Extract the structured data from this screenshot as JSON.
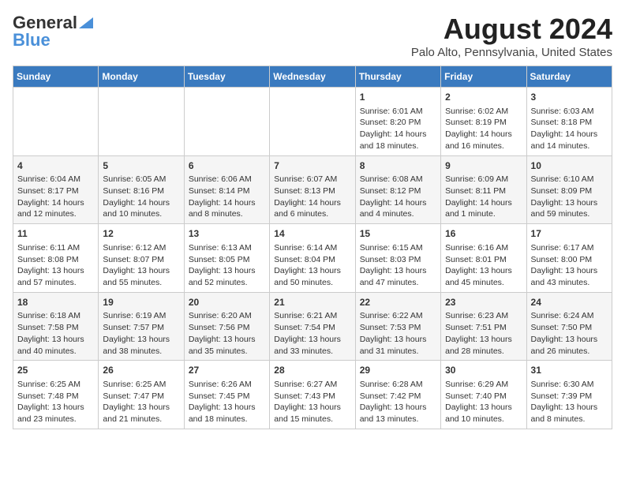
{
  "header": {
    "logo_line1": "General",
    "logo_line2": "Blue",
    "title": "August 2024",
    "subtitle": "Palo Alto, Pennsylvania, United States"
  },
  "days_of_week": [
    "Sunday",
    "Monday",
    "Tuesday",
    "Wednesday",
    "Thursday",
    "Friday",
    "Saturday"
  ],
  "weeks": [
    [
      {
        "day": "",
        "content": ""
      },
      {
        "day": "",
        "content": ""
      },
      {
        "day": "",
        "content": ""
      },
      {
        "day": "",
        "content": ""
      },
      {
        "day": "1",
        "content": "Sunrise: 6:01 AM\nSunset: 8:20 PM\nDaylight: 14 hours\nand 18 minutes."
      },
      {
        "day": "2",
        "content": "Sunrise: 6:02 AM\nSunset: 8:19 PM\nDaylight: 14 hours\nand 16 minutes."
      },
      {
        "day": "3",
        "content": "Sunrise: 6:03 AM\nSunset: 8:18 PM\nDaylight: 14 hours\nand 14 minutes."
      }
    ],
    [
      {
        "day": "4",
        "content": "Sunrise: 6:04 AM\nSunset: 8:17 PM\nDaylight: 14 hours\nand 12 minutes."
      },
      {
        "day": "5",
        "content": "Sunrise: 6:05 AM\nSunset: 8:16 PM\nDaylight: 14 hours\nand 10 minutes."
      },
      {
        "day": "6",
        "content": "Sunrise: 6:06 AM\nSunset: 8:14 PM\nDaylight: 14 hours\nand 8 minutes."
      },
      {
        "day": "7",
        "content": "Sunrise: 6:07 AM\nSunset: 8:13 PM\nDaylight: 14 hours\nand 6 minutes."
      },
      {
        "day": "8",
        "content": "Sunrise: 6:08 AM\nSunset: 8:12 PM\nDaylight: 14 hours\nand 4 minutes."
      },
      {
        "day": "9",
        "content": "Sunrise: 6:09 AM\nSunset: 8:11 PM\nDaylight: 14 hours\nand 1 minute."
      },
      {
        "day": "10",
        "content": "Sunrise: 6:10 AM\nSunset: 8:09 PM\nDaylight: 13 hours\nand 59 minutes."
      }
    ],
    [
      {
        "day": "11",
        "content": "Sunrise: 6:11 AM\nSunset: 8:08 PM\nDaylight: 13 hours\nand 57 minutes."
      },
      {
        "day": "12",
        "content": "Sunrise: 6:12 AM\nSunset: 8:07 PM\nDaylight: 13 hours\nand 55 minutes."
      },
      {
        "day": "13",
        "content": "Sunrise: 6:13 AM\nSunset: 8:05 PM\nDaylight: 13 hours\nand 52 minutes."
      },
      {
        "day": "14",
        "content": "Sunrise: 6:14 AM\nSunset: 8:04 PM\nDaylight: 13 hours\nand 50 minutes."
      },
      {
        "day": "15",
        "content": "Sunrise: 6:15 AM\nSunset: 8:03 PM\nDaylight: 13 hours\nand 47 minutes."
      },
      {
        "day": "16",
        "content": "Sunrise: 6:16 AM\nSunset: 8:01 PM\nDaylight: 13 hours\nand 45 minutes."
      },
      {
        "day": "17",
        "content": "Sunrise: 6:17 AM\nSunset: 8:00 PM\nDaylight: 13 hours\nand 43 minutes."
      }
    ],
    [
      {
        "day": "18",
        "content": "Sunrise: 6:18 AM\nSunset: 7:58 PM\nDaylight: 13 hours\nand 40 minutes."
      },
      {
        "day": "19",
        "content": "Sunrise: 6:19 AM\nSunset: 7:57 PM\nDaylight: 13 hours\nand 38 minutes."
      },
      {
        "day": "20",
        "content": "Sunrise: 6:20 AM\nSunset: 7:56 PM\nDaylight: 13 hours\nand 35 minutes."
      },
      {
        "day": "21",
        "content": "Sunrise: 6:21 AM\nSunset: 7:54 PM\nDaylight: 13 hours\nand 33 minutes."
      },
      {
        "day": "22",
        "content": "Sunrise: 6:22 AM\nSunset: 7:53 PM\nDaylight: 13 hours\nand 31 minutes."
      },
      {
        "day": "23",
        "content": "Sunrise: 6:23 AM\nSunset: 7:51 PM\nDaylight: 13 hours\nand 28 minutes."
      },
      {
        "day": "24",
        "content": "Sunrise: 6:24 AM\nSunset: 7:50 PM\nDaylight: 13 hours\nand 26 minutes."
      }
    ],
    [
      {
        "day": "25",
        "content": "Sunrise: 6:25 AM\nSunset: 7:48 PM\nDaylight: 13 hours\nand 23 minutes."
      },
      {
        "day": "26",
        "content": "Sunrise: 6:25 AM\nSunset: 7:47 PM\nDaylight: 13 hours\nand 21 minutes."
      },
      {
        "day": "27",
        "content": "Sunrise: 6:26 AM\nSunset: 7:45 PM\nDaylight: 13 hours\nand 18 minutes."
      },
      {
        "day": "28",
        "content": "Sunrise: 6:27 AM\nSunset: 7:43 PM\nDaylight: 13 hours\nand 15 minutes."
      },
      {
        "day": "29",
        "content": "Sunrise: 6:28 AM\nSunset: 7:42 PM\nDaylight: 13 hours\nand 13 minutes."
      },
      {
        "day": "30",
        "content": "Sunrise: 6:29 AM\nSunset: 7:40 PM\nDaylight: 13 hours\nand 10 minutes."
      },
      {
        "day": "31",
        "content": "Sunrise: 6:30 AM\nSunset: 7:39 PM\nDaylight: 13 hours\nand 8 minutes."
      }
    ]
  ]
}
